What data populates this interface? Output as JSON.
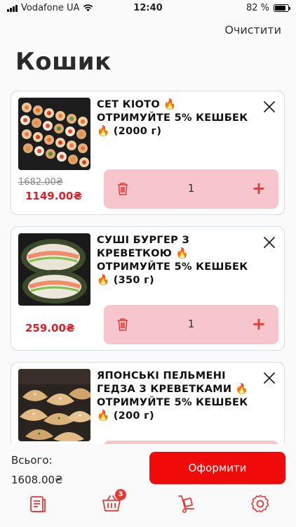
{
  "status_bar": {
    "carrier": "Vodafone UA",
    "time": "12:40",
    "battery_label": "82 %",
    "battery_level": 0.82
  },
  "header": {
    "clear_label": "Очистити",
    "title": "Кошик"
  },
  "cart_items": [
    {
      "title": "СЕТ КІОТО 🔥ОТРИМУЙТЕ 5% КЕШБЕК🔥 (2000 г)",
      "old_price": "1682.00₴",
      "price": "1149.00₴",
      "quantity": "1",
      "image_icon": "sushi-set-image"
    },
    {
      "title": "СУШІ БУРГЕР З КРЕВЕТКОЮ 🔥 ОТРИМУЙТЕ 5% КЕШБЕК 🔥 (350 г)",
      "old_price": "",
      "price": "259.00₴",
      "quantity": "1",
      "image_icon": "sushi-burger-image"
    },
    {
      "title": "ЯПОНСЬКІ ПЕЛЬМЕНІ ГЕДЗА З КРЕВЕТКАМИ 🔥 ОТРИМУЙТЕ 5% КЕШБЕК 🔥 (200 г)",
      "old_price": "",
      "price": "",
      "quantity": "",
      "image_icon": "gyoza-image"
    }
  ],
  "footer": {
    "total_label": "Всього:",
    "total_value": "1608.00₴",
    "checkout_label": "Оформити"
  },
  "tabbar": {
    "cart_badge": "3",
    "icons": [
      "menu-icon",
      "cart-icon",
      "delivery-icon",
      "settings-icon"
    ]
  },
  "colors": {
    "accent": "#f00a0a",
    "price_red": "#d8232a",
    "qty_bg": "#f7c6cc",
    "icon_red": "#e53935"
  }
}
